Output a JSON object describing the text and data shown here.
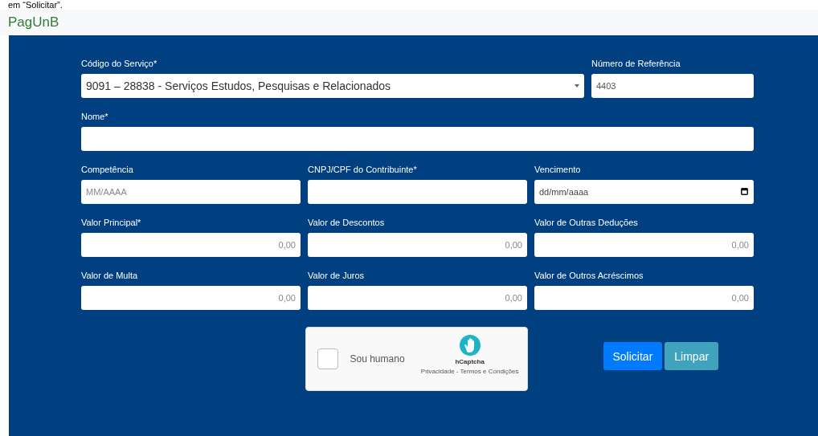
{
  "caption": "em “Solicitar”.",
  "header": {
    "title": "PagUnB"
  },
  "form": {
    "sections": [
      {
        "fields": [
          {
            "kind": "select",
            "label": "Código do Serviço*",
            "value": "9091 – 28838 - Serviços Estudos, Pesquisas e Relacionados"
          },
          {
            "kind": "text",
            "label": "Número de Referência",
            "value": "4403"
          }
        ]
      },
      {
        "fields": [
          {
            "kind": "text",
            "label": "Nome*"
          }
        ]
      },
      {
        "fields": [
          {
            "kind": "text",
            "label": "Competência",
            "placeholder": "MM/AAAA"
          },
          {
            "kind": "text",
            "label": "CNPJ/CPF do Contribuinte*"
          },
          {
            "kind": "date",
            "label": "Vencimento",
            "placeholder": "dd/mm/aaaa"
          }
        ]
      },
      {
        "fields": [
          {
            "kind": "money",
            "label": "Valor Principal*",
            "placeholder": "0,00"
          },
          {
            "kind": "money",
            "label": "Valor de Descontos",
            "placeholder": "0,00"
          },
          {
            "kind": "money",
            "label": "Valor de Outras Deduções",
            "placeholder": "0,00"
          }
        ]
      },
      {
        "fields": [
          {
            "kind": "money",
            "label": "Valor de Multa",
            "placeholder": "0,00"
          },
          {
            "kind": "money",
            "label": "Valor de Juros",
            "placeholder": "0,00"
          },
          {
            "kind": "money",
            "label": "Valor de Outros Acréscimos",
            "placeholder": "0,00"
          }
        ]
      }
    ]
  },
  "captcha": {
    "checked": false,
    "label": "Sou humano",
    "brand": "hCaptcha",
    "links": "Privacidade - Termos e Condições"
  },
  "buttons": [
    {
      "kind": "primary",
      "label": "Solicitar"
    },
    {
      "kind": "info",
      "label": "Limpar"
    }
  ]
}
